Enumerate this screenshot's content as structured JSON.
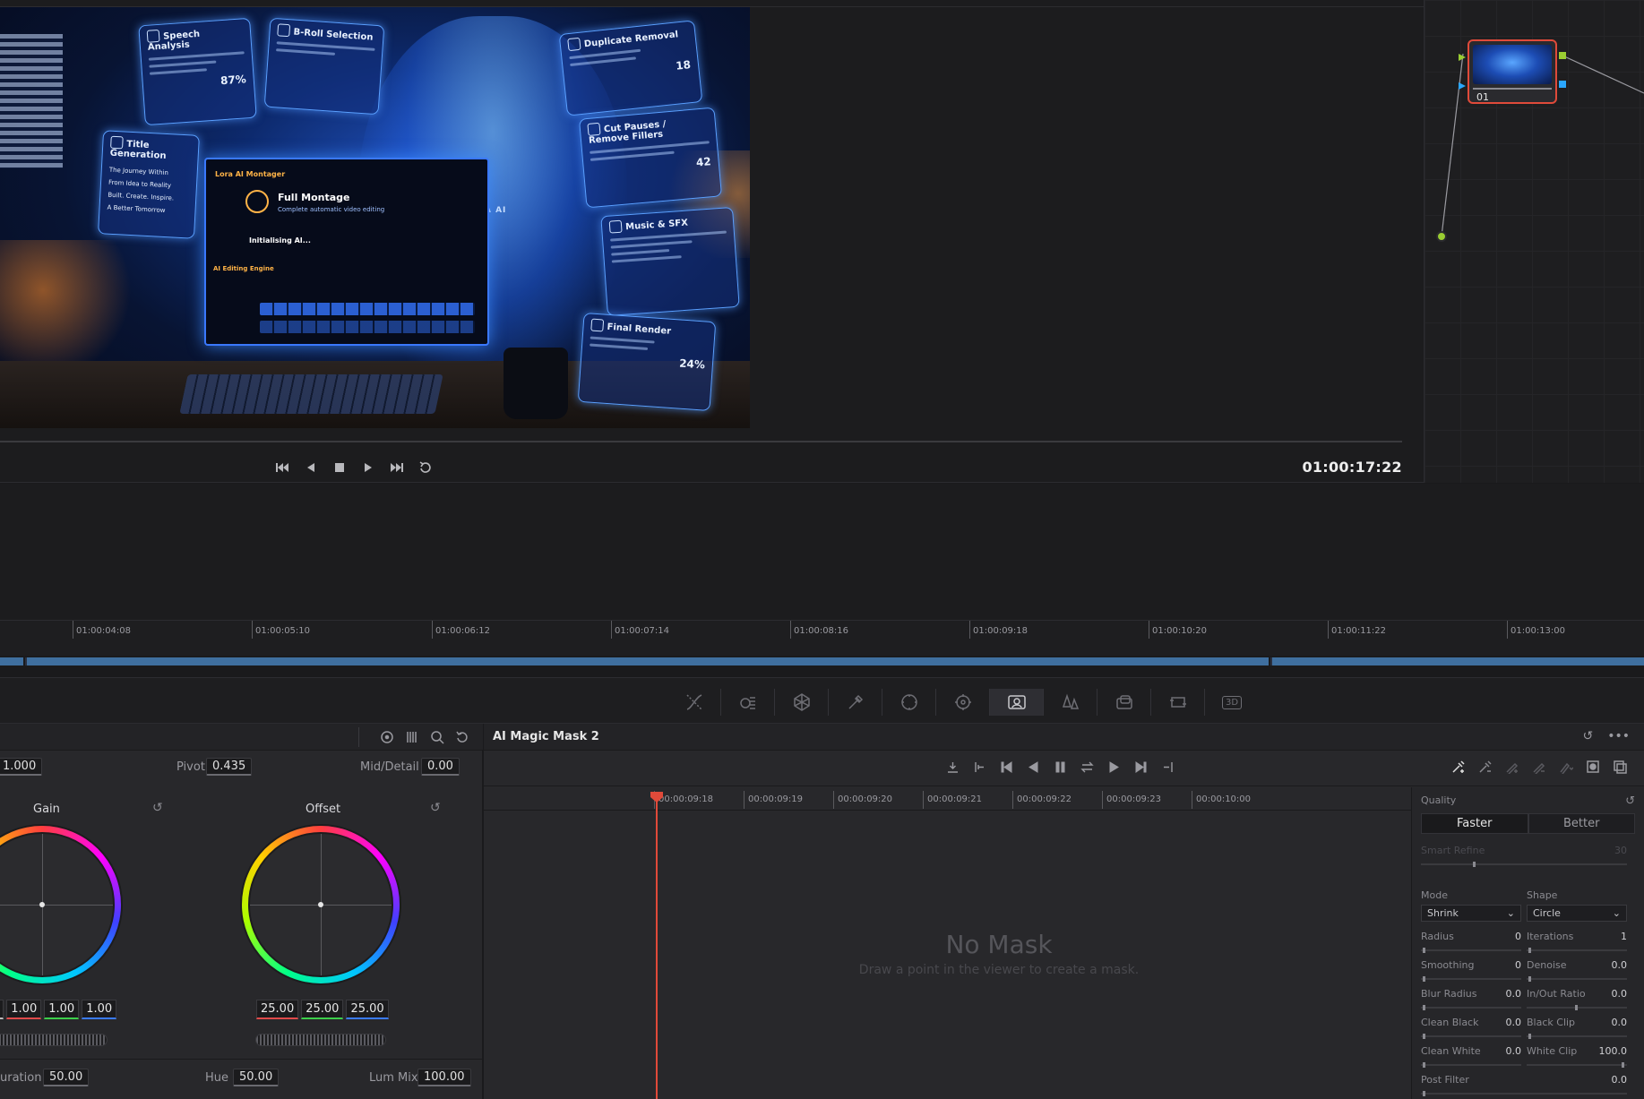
{
  "viewer": {
    "timecode": "01:00:17:22",
    "frame": {
      "cards": {
        "speech": "Speech Analysis",
        "speech_pct": "87%",
        "broll": "B-Roll Selection",
        "dup": "Duplicate Removal",
        "dup_count": "18",
        "title_gen": "Title Generation",
        "title_items": [
          "The Journey Within",
          "From Idea to Reality",
          "Built. Create. Inspire.",
          "A Better Tomorrow"
        ],
        "cut": "Cut Pauses / Remove Fillers",
        "cut_count": "42",
        "music": "Music & SFX",
        "render": "Final Render",
        "render_pct": "24%"
      },
      "monitor": {
        "app": "Lora AI Montager",
        "title": "Full Montage",
        "subtitle": "Complete automatic video editing",
        "status": "Initialising AI...",
        "engine": "AI Editing Engine"
      },
      "figure_label": "LORA AI"
    }
  },
  "node": {
    "label": "01",
    "accent": "#e04a3a",
    "port_green": "#9acd32",
    "port_blue": "#2aa7ff"
  },
  "timeline": {
    "ticks": [
      "01:00:04:08",
      "01:00:05:10",
      "01:00:06:12",
      "01:00:07:14",
      "01:00:08:16",
      "01:00:09:18",
      "01:00:10:20",
      "01:00:11:22",
      "01:00:13:00"
    ],
    "clip_color": "#3f6f9f"
  },
  "palette": {
    "tools": [
      "curves-icon",
      "color-warper-icon",
      "hsl-qualifier-icon",
      "eyedropper-icon",
      "window-icon",
      "tracker-icon",
      "magic-mask-icon",
      "blur-icon",
      "key-icon",
      "sizing-icon",
      "3d-icon"
    ],
    "label_3d": "3D"
  },
  "wheels": {
    "contrast": "1.000",
    "pivot_label": "Pivot",
    "pivot": "0.435",
    "middetail_label": "Mid/Detail",
    "middetail": "0.00",
    "gain": {
      "title": "Gain",
      "values": [
        "1.00",
        "1.00",
        "1.00"
      ],
      "first_partial": "0"
    },
    "offset": {
      "title": "Offset",
      "values": [
        "25.00",
        "25.00",
        "25.00"
      ]
    },
    "saturation_label": "uration",
    "saturation": "50.00",
    "hue_label": "Hue",
    "hue": "50.00",
    "lummix_label": "Lum Mix",
    "lummix": "100.00"
  },
  "mask": {
    "title": "AI Magic Mask 2",
    "ruler": [
      "00:00:09:18",
      "00:00:09:19",
      "00:00:09:20",
      "00:00:09:21",
      "00:00:09:22",
      "00:00:09:23",
      "00:00:10:00"
    ],
    "empty_title": "No Mask",
    "empty_hint": "Draw a point in the viewer to create a mask.",
    "inspector": {
      "quality_label": "Quality",
      "faster": "Faster",
      "better": "Better",
      "smart_refine_label": "Smart Refine",
      "smart_refine": "30",
      "mode_label": "Mode",
      "mode": "Shrink",
      "shape_label": "Shape",
      "shape": "Circle",
      "left": [
        {
          "label": "Radius",
          "value": "0"
        },
        {
          "label": "Smoothing",
          "value": "0"
        },
        {
          "label": "Blur Radius",
          "value": "0.0"
        },
        {
          "label": "Clean Black",
          "value": "0.0"
        },
        {
          "label": "Clean White",
          "value": "0.0"
        }
      ],
      "right": [
        {
          "label": "Iterations",
          "value": "1"
        },
        {
          "label": "Denoise",
          "value": "0.0"
        },
        {
          "label": "In/Out Ratio",
          "value": "0.0"
        },
        {
          "label": "Black Clip",
          "value": "0.0"
        },
        {
          "label": "White Clip",
          "value": "100.0"
        }
      ],
      "post_filter_label": "Post Filter",
      "post_filter": "0.0"
    }
  }
}
